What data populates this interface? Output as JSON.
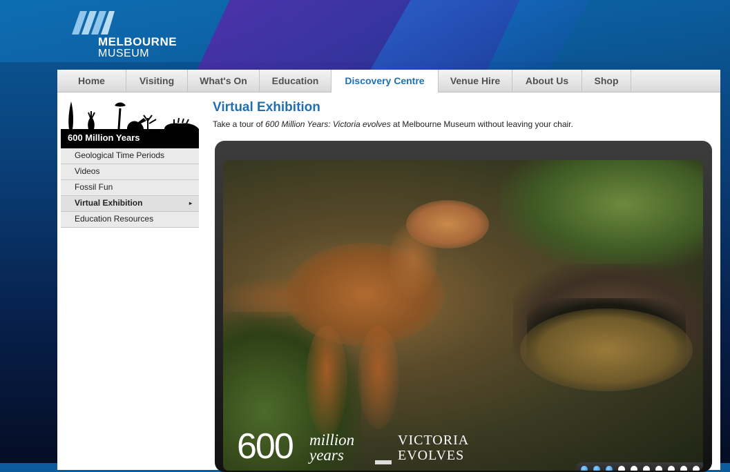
{
  "header": {
    "logo_line1": "MELBOURNE",
    "logo_line2": "MUSEUM",
    "colors": {
      "logo_mark": "#a9d4f2",
      "bg_top": "#0b5d9c",
      "accent_purple": "#5a28aa"
    }
  },
  "nav": {
    "tabs": [
      {
        "label": "Home"
      },
      {
        "label": "Visiting"
      },
      {
        "label": "What's On"
      },
      {
        "label": "Education"
      },
      {
        "label": "Discovery Centre",
        "active": true
      },
      {
        "label": "Venue Hire"
      },
      {
        "label": "About Us"
      },
      {
        "label": "Shop"
      }
    ],
    "active_color": "#1f6fb2"
  },
  "sidebar": {
    "header": "600 Million Years",
    "items": [
      {
        "label": "Geological Time Periods"
      },
      {
        "label": "Videos"
      },
      {
        "label": "Fossil Fun"
      },
      {
        "label": "Virtual Exhibition",
        "active": true
      },
      {
        "label": "Education Resources"
      }
    ],
    "arrow": "▸"
  },
  "content": {
    "title": "Virtual Exhibition",
    "intro_before": "Take a tour of ",
    "intro_italic": "600 Million Years: Victoria evolves",
    "intro_after": " at Melbourne Museum without leaving your chair."
  },
  "viewer": {
    "brand_600": "600",
    "brand_million": "million",
    "brand_years": "years",
    "brand_victoria": "VICTORIA",
    "brand_evolves": "EVOLVES",
    "pager_dots": 10,
    "active_dot_count": 3
  }
}
